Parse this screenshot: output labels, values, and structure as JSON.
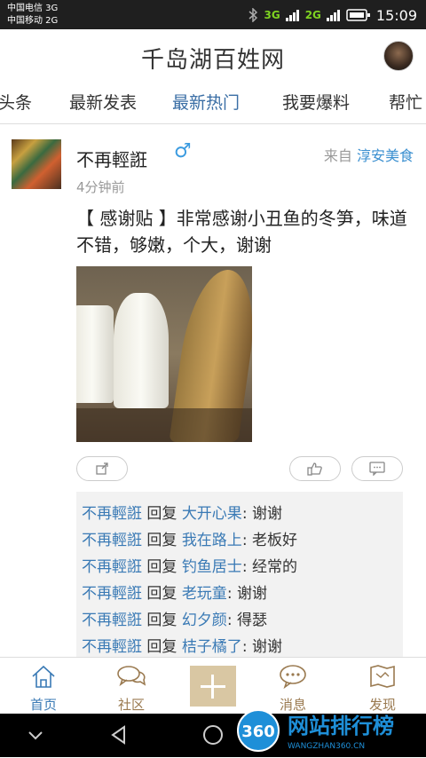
{
  "status_bar": {
    "carrier1": "中国电信 3G",
    "carrier2": "中国移动 2G",
    "net1": "3G",
    "net2": "2G",
    "time": "15:09"
  },
  "header": {
    "title": "千岛湖百姓网"
  },
  "tabs": [
    {
      "label": "头条"
    },
    {
      "label": "最新发表"
    },
    {
      "label": "最新热门"
    },
    {
      "label": "我要爆料"
    },
    {
      "label": "帮忙"
    }
  ],
  "post": {
    "author": "不再輕誑",
    "gender_symbol": "♂",
    "from_prefix": "来自",
    "source": "淳安美食",
    "time": "4分钟前",
    "content": "【 感谢贴 】非常感谢小丑鱼的冬笋，味道不错，够嫩，个大，谢谢"
  },
  "comments": [
    {
      "user": "不再輕誑",
      "verb": "回复",
      "target": "大开心果",
      "text": ": 谢谢"
    },
    {
      "user": "不再輕誑",
      "verb": "回复",
      "target": "我在路上",
      "text": ": 老板好"
    },
    {
      "user": "不再輕誑",
      "verb": "回复",
      "target": "钓鱼居士",
      "text": ": 经常的"
    },
    {
      "user": "不再輕誑",
      "verb": "回复",
      "target": "老玩童",
      "text": ": 谢谢"
    },
    {
      "user": "不再輕誑",
      "verb": "回复",
      "target": "幻夕颜",
      "text": ": 得瑟"
    },
    {
      "user": "不再輕誑",
      "verb": "回复",
      "target": "桔子橘了",
      "text": ": 谢谢"
    }
  ],
  "bottom_nav": [
    {
      "label": "首页"
    },
    {
      "label": "社区"
    },
    {
      "label": "消息"
    },
    {
      "label": "发现"
    }
  ],
  "watermark": {
    "badge": "360",
    "text": "网站排行榜",
    "domain": "WANGZHAN360.CN"
  },
  "colors": {
    "accent_blue": "#3a7ab5",
    "nav_brown": "#9a7a50",
    "plus_bg": "#d9c7a3"
  }
}
